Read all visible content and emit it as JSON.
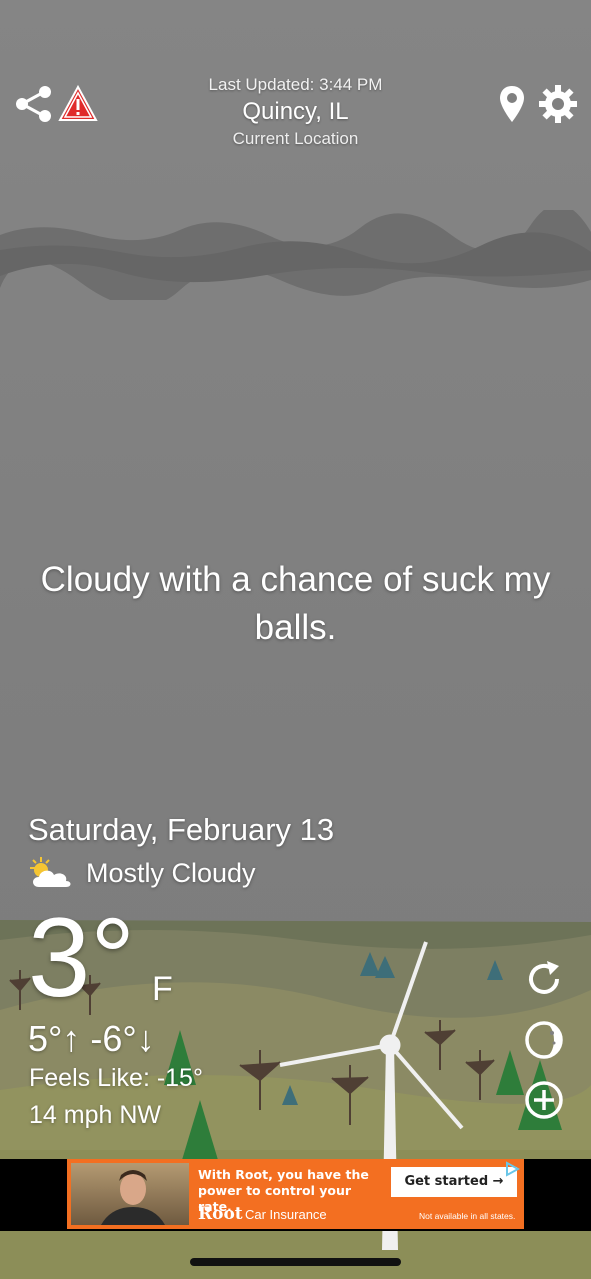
{
  "header": {
    "last_updated": "Last Updated: 3:44 PM",
    "city": "Quincy, IL",
    "location_label": "Current Location"
  },
  "toolbar": {
    "left_icons": [
      "share-icon",
      "alert-icon"
    ],
    "right_icons": [
      "location-pin-icon",
      "gear-icon"
    ]
  },
  "quip": "Cloudy with a chance of suck my balls.",
  "weather": {
    "date": "Saturday, February 13",
    "condition_icon": "partly-cloudy-icon",
    "condition": "Mostly Cloudy",
    "temperature": "3°",
    "unit": "F",
    "hi_lo": "5°↑ -6°↓",
    "feels_like": "Feels Like: -15°",
    "wind": "14 mph NW"
  },
  "side_actions": [
    "refresh-icon",
    "moon-phase-icon",
    "add-icon"
  ],
  "ad": {
    "headline": "With Root, you have the power to control your rate.",
    "brand": "Root",
    "brand_suffix": "Car Insurance",
    "cta": "Get started →",
    "disclaimer": "Not available in all states."
  },
  "colors": {
    "sky": "#808080",
    "ad_orange": "#f36f21",
    "alert_red": "#e02b2b",
    "hill_green": "#7f8a5a",
    "tree_green": "#2e7d3a"
  }
}
